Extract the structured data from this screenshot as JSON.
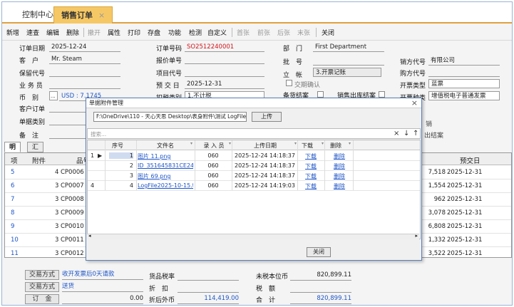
{
  "tabs": [
    {
      "label": "控制中心",
      "active": false
    },
    {
      "label": "销售订单",
      "active": true,
      "close": "×"
    }
  ],
  "toolbar": {
    "items": [
      {
        "label": "新增",
        "enabled": true
      },
      {
        "label": "速查",
        "enabled": true
      },
      {
        "label": "编辑",
        "enabled": true
      },
      {
        "label": "删除",
        "enabled": true
      },
      {
        "label": "撤开",
        "enabled": false
      },
      {
        "label": "属性",
        "enabled": true
      },
      {
        "label": "打印",
        "enabled": true
      },
      {
        "label": "存盘",
        "enabled": true
      },
      {
        "label": "功能",
        "enabled": true
      },
      {
        "label": "检测",
        "enabled": true
      },
      {
        "label": "自定义",
        "enabled": true
      },
      {
        "label": "首张",
        "enabled": false
      },
      {
        "label": "前张",
        "enabled": false
      },
      {
        "label": "后张",
        "enabled": false
      },
      {
        "label": "末张",
        "enabled": false
      },
      {
        "label": "关闭",
        "enabled": true
      }
    ]
  },
  "form": {
    "order_date_label": "订单日期",
    "order_date": "2025-12-24",
    "customer_label": "客　户",
    "customer": "Mr. Steam",
    "warranty_label": "保留代号",
    "warranty": "",
    "salesman_label": "业 务 员",
    "salesman": "",
    "currency_label": "币　别",
    "currency_btn": "...",
    "currency": "USD : 7.1745",
    "customer_order_label": "客户订单",
    "customer_order": "",
    "doc_type_label": "单据类别",
    "doc_type": "",
    "remark_label": "备　注",
    "remark": "",
    "order_no_label": "订单号码",
    "order_no": "SO2512240001",
    "quote_no_label": "报价单号",
    "quote_no": "",
    "project_label": "项目代号",
    "project": "",
    "expected_label": "预 交 日",
    "expected": "2025-12-31",
    "tax_type_label": "扣税类别",
    "tax_type": "1.不计税",
    "dept_label": "部　门",
    "dept": "First Department",
    "batch_label": "批　号",
    "batch": "",
    "account_label": "立　帐",
    "account": "3.开票记账",
    "bill_confirm_label": "交期确认",
    "stock_close_label": "备货结案",
    "sales_close_label": "销售出库结案",
    "vendor_code_label": "销方代号",
    "vendor_code": "有限公司",
    "buyer_code_label": "购方代号",
    "buyer_code": "",
    "invoice_type_label": "开票类型",
    "invoice_type": "蓝票",
    "invoice_kind_label": "开票种类",
    "invoice_kind": "增值税电子普通发票",
    "hidden_label_1": "销",
    "hidden_label_2": "出结案"
  },
  "grid_tabs": [
    {
      "label": "明细",
      "active": true
    },
    {
      "label": "汇总",
      "active": false
    }
  ],
  "grid": {
    "columns": {
      "item": "项",
      "attach": "附件",
      "product": "品号",
      "expected": "预交日"
    },
    "rows": [
      {
        "item": "5",
        "attach": "4",
        "product": "CP0006",
        "amount": "7,518",
        "date": "2025-12-31"
      },
      {
        "item": "6",
        "attach": "3",
        "product": "CP0007",
        "amount": "1,554",
        "date": "2025-12-31"
      },
      {
        "item": "7",
        "attach": "3",
        "product": "CP0008",
        "amount": "962",
        "date": "2025-12-31"
      },
      {
        "item": "8",
        "attach": "3",
        "product": "CP0009",
        "amount": "3,078",
        "date": "2025-12-31"
      },
      {
        "item": "9",
        "attach": "3",
        "product": "CP0010",
        "amount": "6,808",
        "date": "2025-12-31"
      },
      {
        "item": "10",
        "attach": "3",
        "product": "CP0011",
        "amount": "1,332",
        "date": "2025-12-31"
      },
      {
        "item": "11",
        "attach": "3",
        "product": "CP0012",
        "amount": "3,522",
        "date": "2025-12-31"
      }
    ]
  },
  "footer": {
    "trade_btn_1": "交易方式",
    "trade_val_1": "收开发票后0天请款",
    "trade_btn_2": "交易方式",
    "trade_val_2": "送货",
    "deposit_btn": "订　金",
    "deposit": "0.00",
    "goods_tax_label": "货品税率",
    "goods_tax": "",
    "discount_label": "折　扣",
    "discount": "",
    "after_disc_label": "折后外币",
    "after_disc": "114,419.00",
    "untaxed_label": "未税本位币",
    "untaxed": "820,899.11",
    "tax_label": "税　额",
    "tax": "",
    "total_label": "合　计",
    "total": "820,899.11"
  },
  "modal": {
    "title": "单据附件管理",
    "close": "×",
    "path": "F:\\OneDrive\\110 - 天心天思 Desktop\\表身附件\\测试 LogFile2025-10-1",
    "upload": "上传",
    "search_placeholder": "搜索...",
    "search_icons": {
      "clear": "×",
      "down": "↓",
      "up": "↑"
    },
    "columns": {
      "seq": "序号",
      "filename": "文件名",
      "uploader": "录 入 员",
      "date": "上传日期",
      "download": "下载",
      "delete": "删除"
    },
    "rows": [
      {
        "row": "1",
        "seq": "1",
        "filename": "图片 11.png",
        "uploader": "060",
        "date": "2025-12-24 14:18:37",
        "download": "下载",
        "delete": "删除",
        "selected": true
      },
      {
        "row": "",
        "seq": "2",
        "filename": "ID_351645831CE24FB7A5",
        "uploader": "060",
        "date": "2025-12-24 14:18:37",
        "download": "下载",
        "delete": "删除",
        "selected": false
      },
      {
        "row": "",
        "seq": "3",
        "filename": "图片 69.png",
        "uploader": "060",
        "date": "2025-12-24 14:18:37",
        "download": "下载",
        "delete": "删除",
        "selected": false
      },
      {
        "row": "4",
        "seq": "4",
        "filename": "LogFile2025-10-15.txt",
        "uploader": "060",
        "date": "2025-12-24 14:19:03",
        "download": "下载",
        "delete": "删除",
        "selected": false
      }
    ],
    "close_btn": "关闭"
  }
}
